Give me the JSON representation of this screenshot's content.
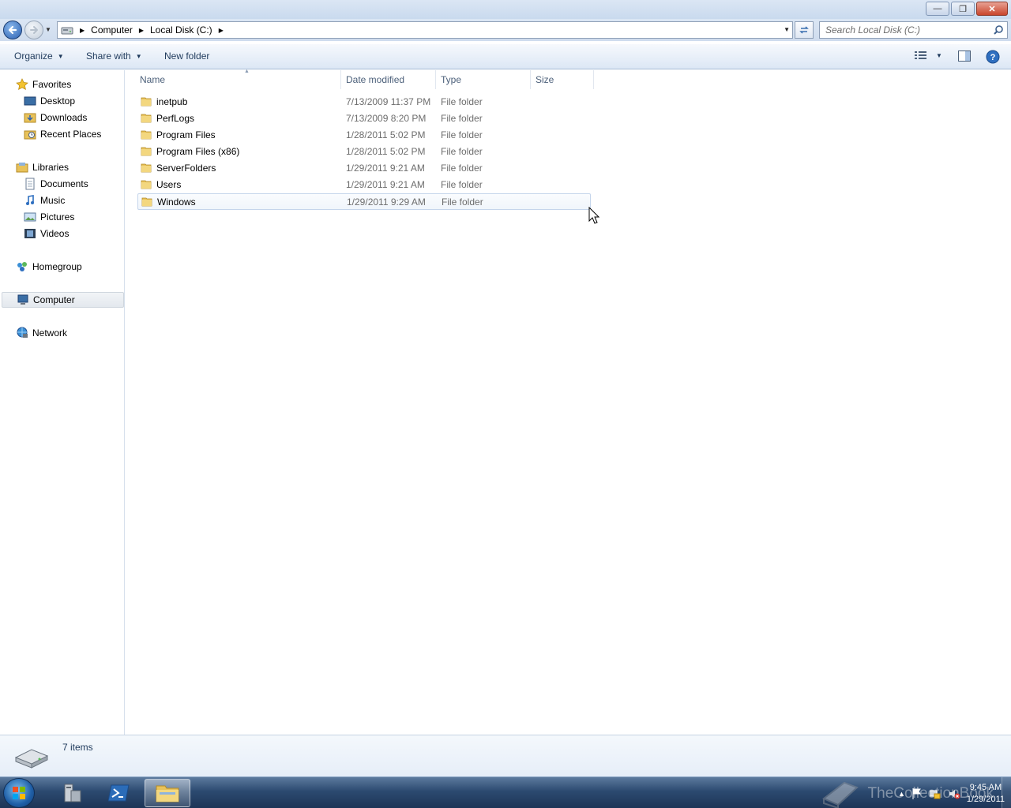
{
  "window": {
    "controls": {
      "minimize": "—",
      "maximize": "❐",
      "close": "✕"
    }
  },
  "address_bar": {
    "breadcrumbs": [
      "Computer",
      "Local Disk (C:)"
    ],
    "search_placeholder": "Search Local Disk (C:)"
  },
  "toolbar": {
    "organize": "Organize",
    "share_with": "Share with",
    "new_folder": "New folder"
  },
  "nav": {
    "favorites": {
      "label": "Favorites",
      "items": [
        "Desktop",
        "Downloads",
        "Recent Places"
      ]
    },
    "libraries": {
      "label": "Libraries",
      "items": [
        "Documents",
        "Music",
        "Pictures",
        "Videos"
      ]
    },
    "homegroup": "Homegroup",
    "computer": "Computer",
    "network": "Network"
  },
  "columns": {
    "name": "Name",
    "date": "Date modified",
    "type": "Type",
    "size": "Size"
  },
  "files": [
    {
      "name": "inetpub",
      "date": "7/13/2009 11:37 PM",
      "type": "File folder"
    },
    {
      "name": "PerfLogs",
      "date": "7/13/2009 8:20 PM",
      "type": "File folder"
    },
    {
      "name": "Program Files",
      "date": "1/28/2011 5:02 PM",
      "type": "File folder"
    },
    {
      "name": "Program Files (x86)",
      "date": "1/28/2011 5:02 PM",
      "type": "File folder"
    },
    {
      "name": "ServerFolders",
      "date": "1/29/2011 9:21 AM",
      "type": "File folder"
    },
    {
      "name": "Users",
      "date": "1/29/2011 9:21 AM",
      "type": "File folder"
    },
    {
      "name": "Windows",
      "date": "1/29/2011 9:29 AM",
      "type": "File folder"
    }
  ],
  "details": {
    "item_count": "7 items"
  },
  "taskbar": {
    "clock_time": "9:45 AM",
    "clock_date": "1/29/2011",
    "watermark": "TheCollectionBook"
  },
  "colors": {
    "accent": "#1e395b",
    "selection": "#c5d5eb",
    "folder": "#e8c25a"
  }
}
